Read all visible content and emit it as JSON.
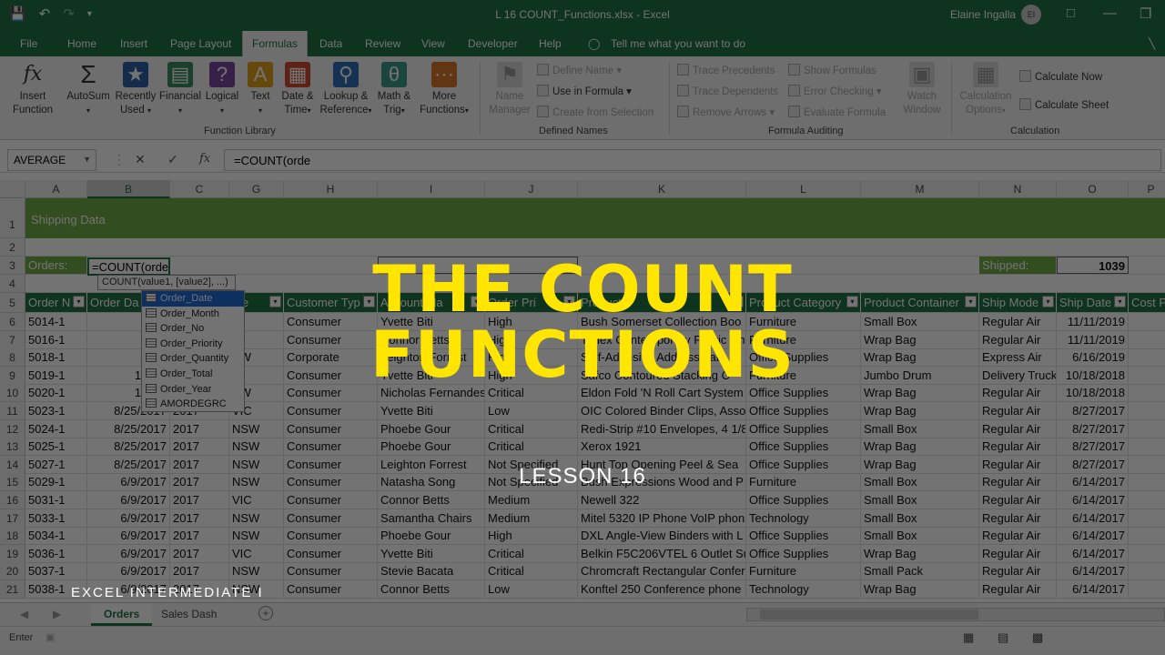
{
  "window": {
    "title": "L 16 COUNT_Functions.xlsx  -  Excel",
    "user": "Elaine Ingalla",
    "avatar": "EI",
    "qat_icons": [
      "save-icon",
      "undo-icon",
      "redo-icon",
      "customize-icon"
    ],
    "controls": [
      "ribbon-display-icon",
      "minimize-icon",
      "restore-icon",
      "close-icon"
    ]
  },
  "menu": {
    "tabs": [
      "File",
      "Home",
      "Insert",
      "Page Layout",
      "Formulas",
      "Data",
      "Review",
      "View",
      "Developer",
      "Help"
    ],
    "active": "Formulas",
    "tell_me": "Tell me what you want to do"
  },
  "ribbon": {
    "insert_function": [
      "Insert",
      "Function"
    ],
    "autosum": [
      "AutoSum"
    ],
    "recently_used": [
      "Recently",
      "Used"
    ],
    "financial": [
      "Financial"
    ],
    "logical": [
      "Logical"
    ],
    "text": [
      "Text"
    ],
    "date_time": [
      "Date &",
      "Time"
    ],
    "lookup": [
      "Lookup &",
      "Reference"
    ],
    "math": [
      "Math &",
      "Trig"
    ],
    "more": [
      "More",
      "Functions"
    ],
    "name_manager": [
      "Name",
      "Manager"
    ],
    "define_name": "Define Name",
    "use_in_formula": "Use in Formula",
    "create_from_selection": "Create from Selection",
    "trace_precedents": "Trace Precedents",
    "trace_dependents": "Trace Dependents",
    "remove_arrows": "Remove Arrows",
    "show_formulas": "Show Formulas",
    "error_checking": "Error Checking",
    "evaluate_formula": "Evaluate Formula",
    "watch_window": [
      "Watch",
      "Window"
    ],
    "calc_options": [
      "Calculation",
      "Options"
    ],
    "calc_now": "Calculate Now",
    "calc_sheet": "Calculate Sheet",
    "groups": [
      "Function Library",
      "Defined Names",
      "Formula Auditing",
      "Calculation"
    ]
  },
  "formula_bar": {
    "name_box": "AVERAGE",
    "formula": "=COUNT(orde"
  },
  "columns": [
    "A",
    "B",
    "C",
    "G",
    "H",
    "I",
    "J",
    "K",
    "L",
    "M",
    "N",
    "O",
    "P"
  ],
  "sheet": {
    "title": "Shipping Data",
    "orders_label": "Orders:",
    "active_cell_value": "=COUNT(orde",
    "shipped_label": "Shipped:",
    "shipped_value": "1039",
    "tooltip": "COUNT(value1, [value2], ...)",
    "headers": [
      "Order N",
      "Order Da",
      "",
      "ate",
      "Customer Typ",
      "Account Ma",
      "Order Pri",
      "Product",
      "Product Category",
      "Product Container",
      "Ship Mode",
      "Ship Date",
      "Cost P"
    ],
    "rows": [
      [
        "5014-1",
        "11/8,",
        "",
        "C",
        "Consumer",
        "Yvette Biti",
        "High",
        "Bush Somerset Collection Boo",
        "Furniture",
        "Small Box",
        "Regular Air",
        "11/11/2019"
      ],
      [
        "5016-1",
        "11/8,",
        "",
        "C",
        "Consumer",
        "Connor Betts",
        "High",
        "Tenex Contemporary Fabric Cho",
        "Furniture",
        "Wrap Bag",
        "Regular Air",
        "11/11/2019"
      ],
      [
        "5018-1",
        "6/12,",
        "",
        "SW",
        "Corporate",
        "Leighton Forrest",
        "High",
        "Self-Adhesive Address Lab",
        "Office Supplies",
        "Wrap Bag",
        "Express Air",
        "6/16/2019"
      ],
      [
        "5019-1",
        "10/11,",
        "",
        "C",
        "Consumer",
        "Yvette Biti",
        "High",
        "Safco Contoured Stacking C",
        "Furniture",
        "Jumbo Drum",
        "Delivery Truck",
        "10/18/2018"
      ],
      [
        "5020-1",
        "10/11,",
        "",
        "SW",
        "Consumer",
        "Nicholas Fernandes",
        "Critical",
        "Eldon Fold 'N Roll Cart System",
        "Office Supplies",
        "Wrap Bag",
        "Regular Air",
        "10/18/2018"
      ],
      [
        "5023-1",
        "8/25/2017",
        "2017",
        "VIC",
        "Consumer",
        "Yvette Biti",
        "Low",
        "OIC Colored Binder Clips, Asso",
        "Office Supplies",
        "Wrap Bag",
        "Regular Air",
        "8/27/2017"
      ],
      [
        "5024-1",
        "8/25/2017",
        "2017",
        "NSW",
        "Consumer",
        "Phoebe Gour",
        "Critical",
        "Redi-Strip #10 Envelopes, 4 1/8",
        "Office Supplies",
        "Small Box",
        "Regular Air",
        "8/27/2017"
      ],
      [
        "5025-1",
        "8/25/2017",
        "2017",
        "NSW",
        "Consumer",
        "Phoebe Gour",
        "Critical",
        "Xerox 1921",
        "Office Supplies",
        "Wrap Bag",
        "Regular Air",
        "8/27/2017"
      ],
      [
        "5027-1",
        "8/25/2017",
        "2017",
        "NSW",
        "Consumer",
        "Leighton Forrest",
        "Not Specified",
        "Hunt Top Opening Peel & Sea",
        "Office Supplies",
        "Wrap Bag",
        "Regular Air",
        "8/27/2017"
      ],
      [
        "5029-1",
        "6/9/2017",
        "2017",
        "NSW",
        "Consumer",
        "Natasha Song",
        "Not Specified",
        "Bush Expressions Wood and P",
        "Furniture",
        "Small Box",
        "Regular Air",
        "6/14/2017"
      ],
      [
        "5031-1",
        "6/9/2017",
        "2017",
        "VIC",
        "Consumer",
        "Connor Betts",
        "Medium",
        "Newell 322",
        "Office Supplies",
        "Small Box",
        "Regular Air",
        "6/14/2017"
      ],
      [
        "5033-1",
        "6/9/2017",
        "2017",
        "NSW",
        "Consumer",
        "Samantha Chairs",
        "Medium",
        "Mitel 5320 IP Phone VoIP phon",
        "Technology",
        "Small Box",
        "Regular Air",
        "6/14/2017"
      ],
      [
        "5034-1",
        "6/9/2017",
        "2017",
        "NSW",
        "Consumer",
        "Phoebe Gour",
        "High",
        "DXL Angle-View Binders with L",
        "Office Supplies",
        "Small Box",
        "Regular Air",
        "6/14/2017"
      ],
      [
        "5036-1",
        "6/9/2017",
        "2017",
        "VIC",
        "Consumer",
        "Yvette Biti",
        "Critical",
        "Belkin F5C206VTEL 6 Outlet Su",
        "Office Supplies",
        "Wrap Bag",
        "Regular Air",
        "6/14/2017"
      ],
      [
        "5037-1",
        "6/9/2017",
        "2017",
        "NSW",
        "Consumer",
        "Stevie Bacata",
        "Critical",
        "Chromcraft Rectangular Confer",
        "Furniture",
        "Small Pack",
        "Regular Air",
        "6/14/2017"
      ],
      [
        "5038-1",
        "6/9/2017",
        "2017",
        "NSW",
        "Consumer",
        "Connor Betts",
        "Low",
        "Konftel 250 Conference phone",
        "Technology",
        "Wrap Bag",
        "Regular Air",
        "6/14/2017"
      ]
    ]
  },
  "autocomplete": [
    "Order_Date",
    "Order_Month",
    "Order_No",
    "Order_Priority",
    "Order_Quantity",
    "Order_Total",
    "Order_Year",
    "AMORDEGRC"
  ],
  "sheet_tabs": [
    "Orders",
    "Sales Dash"
  ],
  "status": {
    "mode": "Enter"
  },
  "overlay": {
    "title_line1": "THE COUNT",
    "title_line2": "FUNCTIONS",
    "lesson": "LESSON 16",
    "course": "EXCEL INTERMEDIATE I",
    "title_color": "#ffe500"
  },
  "colors": {
    "excel_green": "#217346",
    "table_header": "#217346",
    "banner": "#70ad47"
  }
}
